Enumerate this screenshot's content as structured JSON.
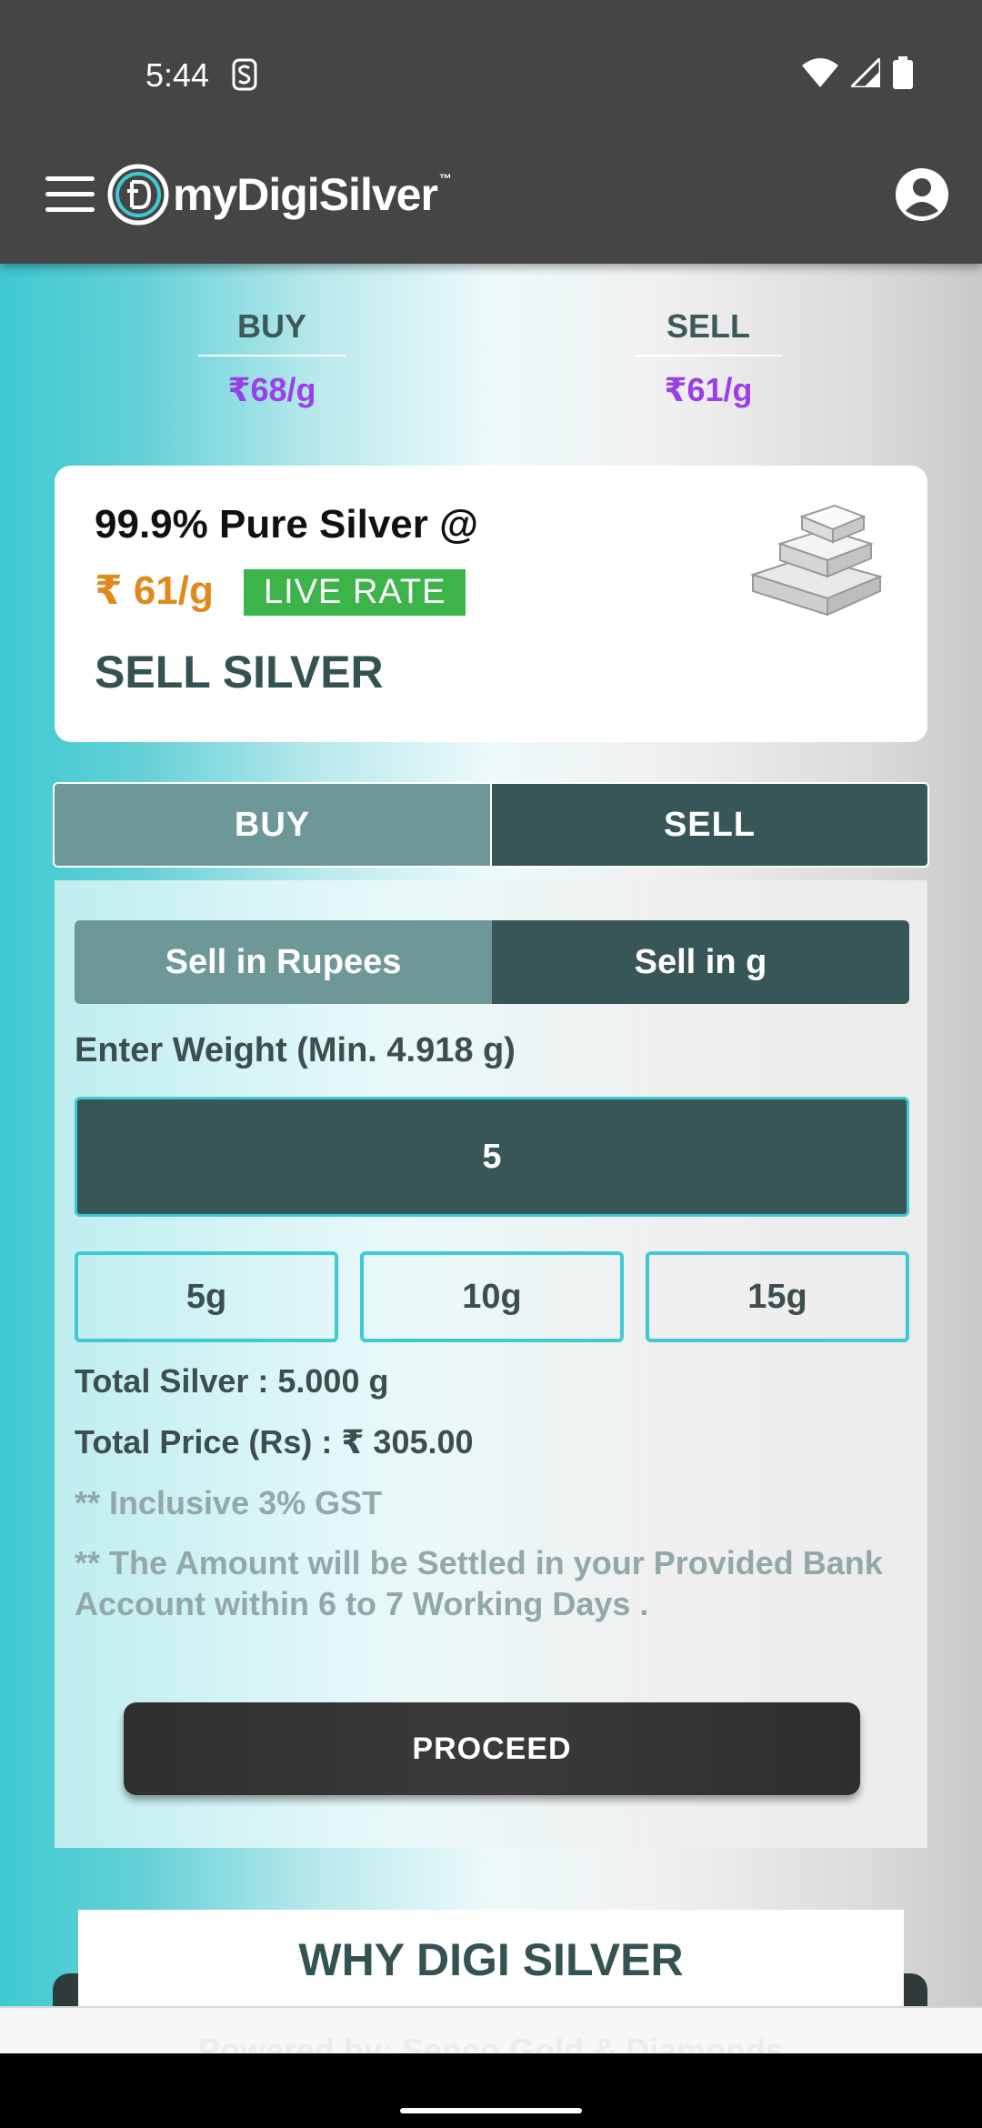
{
  "status_bar": {
    "time": "5:44",
    "icons": [
      "s-app-icon",
      "wifi-icon",
      "signal-icon",
      "battery-icon"
    ]
  },
  "app_bar": {
    "brand": "myDigiSilver",
    "trademark": "™",
    "menu_icon": "hamburger-menu-icon",
    "profile_icon": "account-circle-icon"
  },
  "rates": {
    "buy": {
      "label": "BUY",
      "value": "₹68/g"
    },
    "sell": {
      "label": "SELL",
      "value": "₹61/g"
    }
  },
  "info_card": {
    "title": "99.9% Pure Silver @",
    "rate": "₹ 61/g",
    "badge": "LIVE RATE",
    "action": "SELL SILVER"
  },
  "tabs": {
    "buy": "BUY",
    "sell": "SELL",
    "active": "SELL"
  },
  "sell_panel": {
    "mode_rupees": "Sell in Rupees",
    "mode_grams": "Sell in g",
    "active_mode": "Sell in g",
    "weight_label": "Enter Weight (Min. 4.918 g)",
    "weight_value": "5",
    "chips": [
      "5g",
      "10g",
      "15g"
    ],
    "total_silver": "Total Silver : 5.000 g",
    "total_price": "Total Price (Rs) : ₹ 305.00",
    "gst_note": "** Inclusive 3% GST",
    "settlement_note": "** The Amount will be Settled in your Provided Bank Account within 6 to 7 Working Days .",
    "proceed": "PROCEED"
  },
  "why_section": {
    "title": "WHY DIGI SILVER"
  },
  "footer": {
    "text": "Powered by: Senco Gold & Diamonds"
  },
  "colors": {
    "rate_purple": "#9b40e8",
    "live_green": "#3cb449",
    "accent_teal": "#3fc9d2",
    "dark_teal": "#385656",
    "gold_orange": "#e08a1e"
  }
}
